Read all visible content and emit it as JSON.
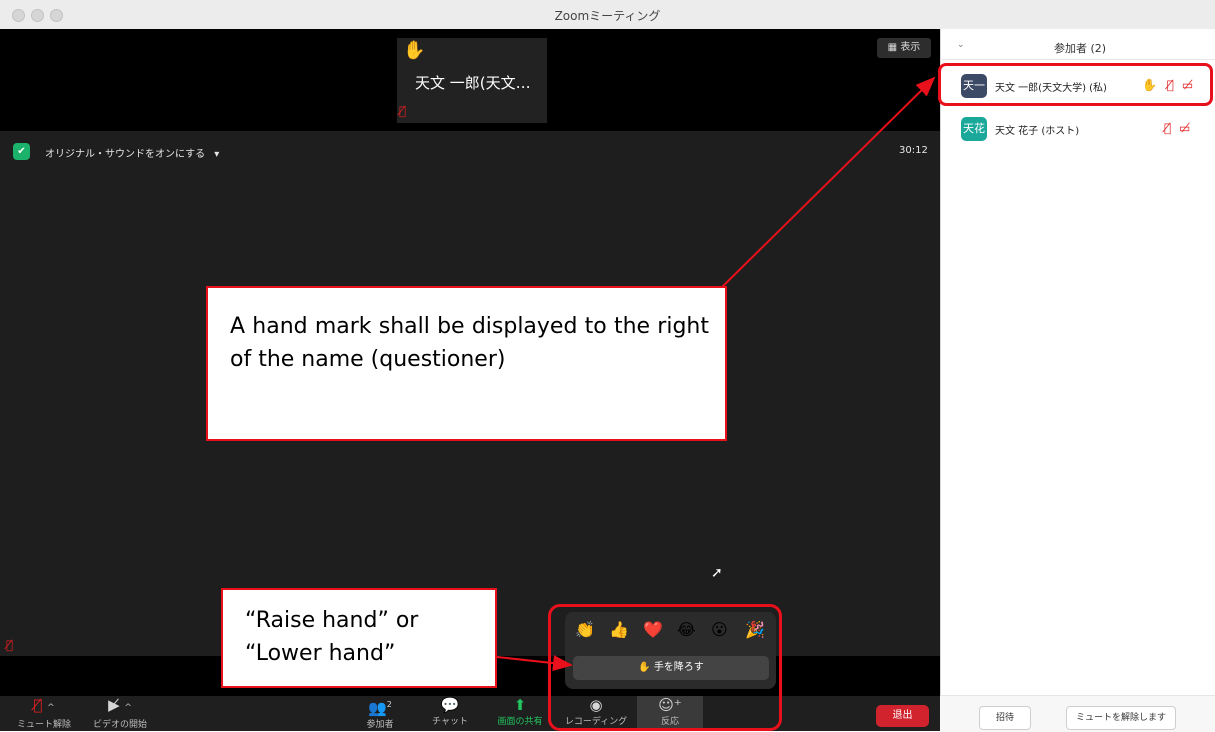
{
  "window": {
    "title": "Zoomミーティング"
  },
  "thumbnail": {
    "name": "天文 一郎(天文…",
    "hand_icon": "raised-hand-icon",
    "mic_icon": "mic-muted-icon"
  },
  "top_right": {
    "view_label": "表示"
  },
  "meeting": {
    "original_sound_label": "オリジナル・サウンドをオンにする",
    "timer": "30:12"
  },
  "toolbar": {
    "unmute_label": "ミュート解除",
    "video_label": "ビデオの開始",
    "participants_label": "参加者",
    "participants_count": "2",
    "chat_label": "チャット",
    "share_label": "画面の共有",
    "record_label": "レコーディング",
    "reactions_label": "反応",
    "end_label": "退出",
    "share_color": "#22c55e",
    "end_color": "#d0232d"
  },
  "reactions": {
    "emojis": [
      "👏",
      "👍",
      "❤️",
      "😂",
      "😮",
      "🎉"
    ],
    "lower_hand_label": "手を降ろす"
  },
  "participants_panel": {
    "title": "参加者 (2)",
    "participants": [
      {
        "avatar": "天一",
        "name": "天文 一郎(天文大学) (私)",
        "avatar_color": "#3d4a66",
        "hand_raised": true
      },
      {
        "avatar": "天花",
        "name": "天文 花子 (ホスト)",
        "avatar_color": "#19a89a",
        "hand_raised": false
      }
    ],
    "invite_label": "招待",
    "unmute_all_label": "ミュートを解除します"
  },
  "annotations": {
    "callout_hand": "A hand mark shall be displayed to the right of the name (questioner)",
    "callout_raise": "“Raise hand” or “Lower hand”",
    "accent_color": "#e8101a"
  }
}
